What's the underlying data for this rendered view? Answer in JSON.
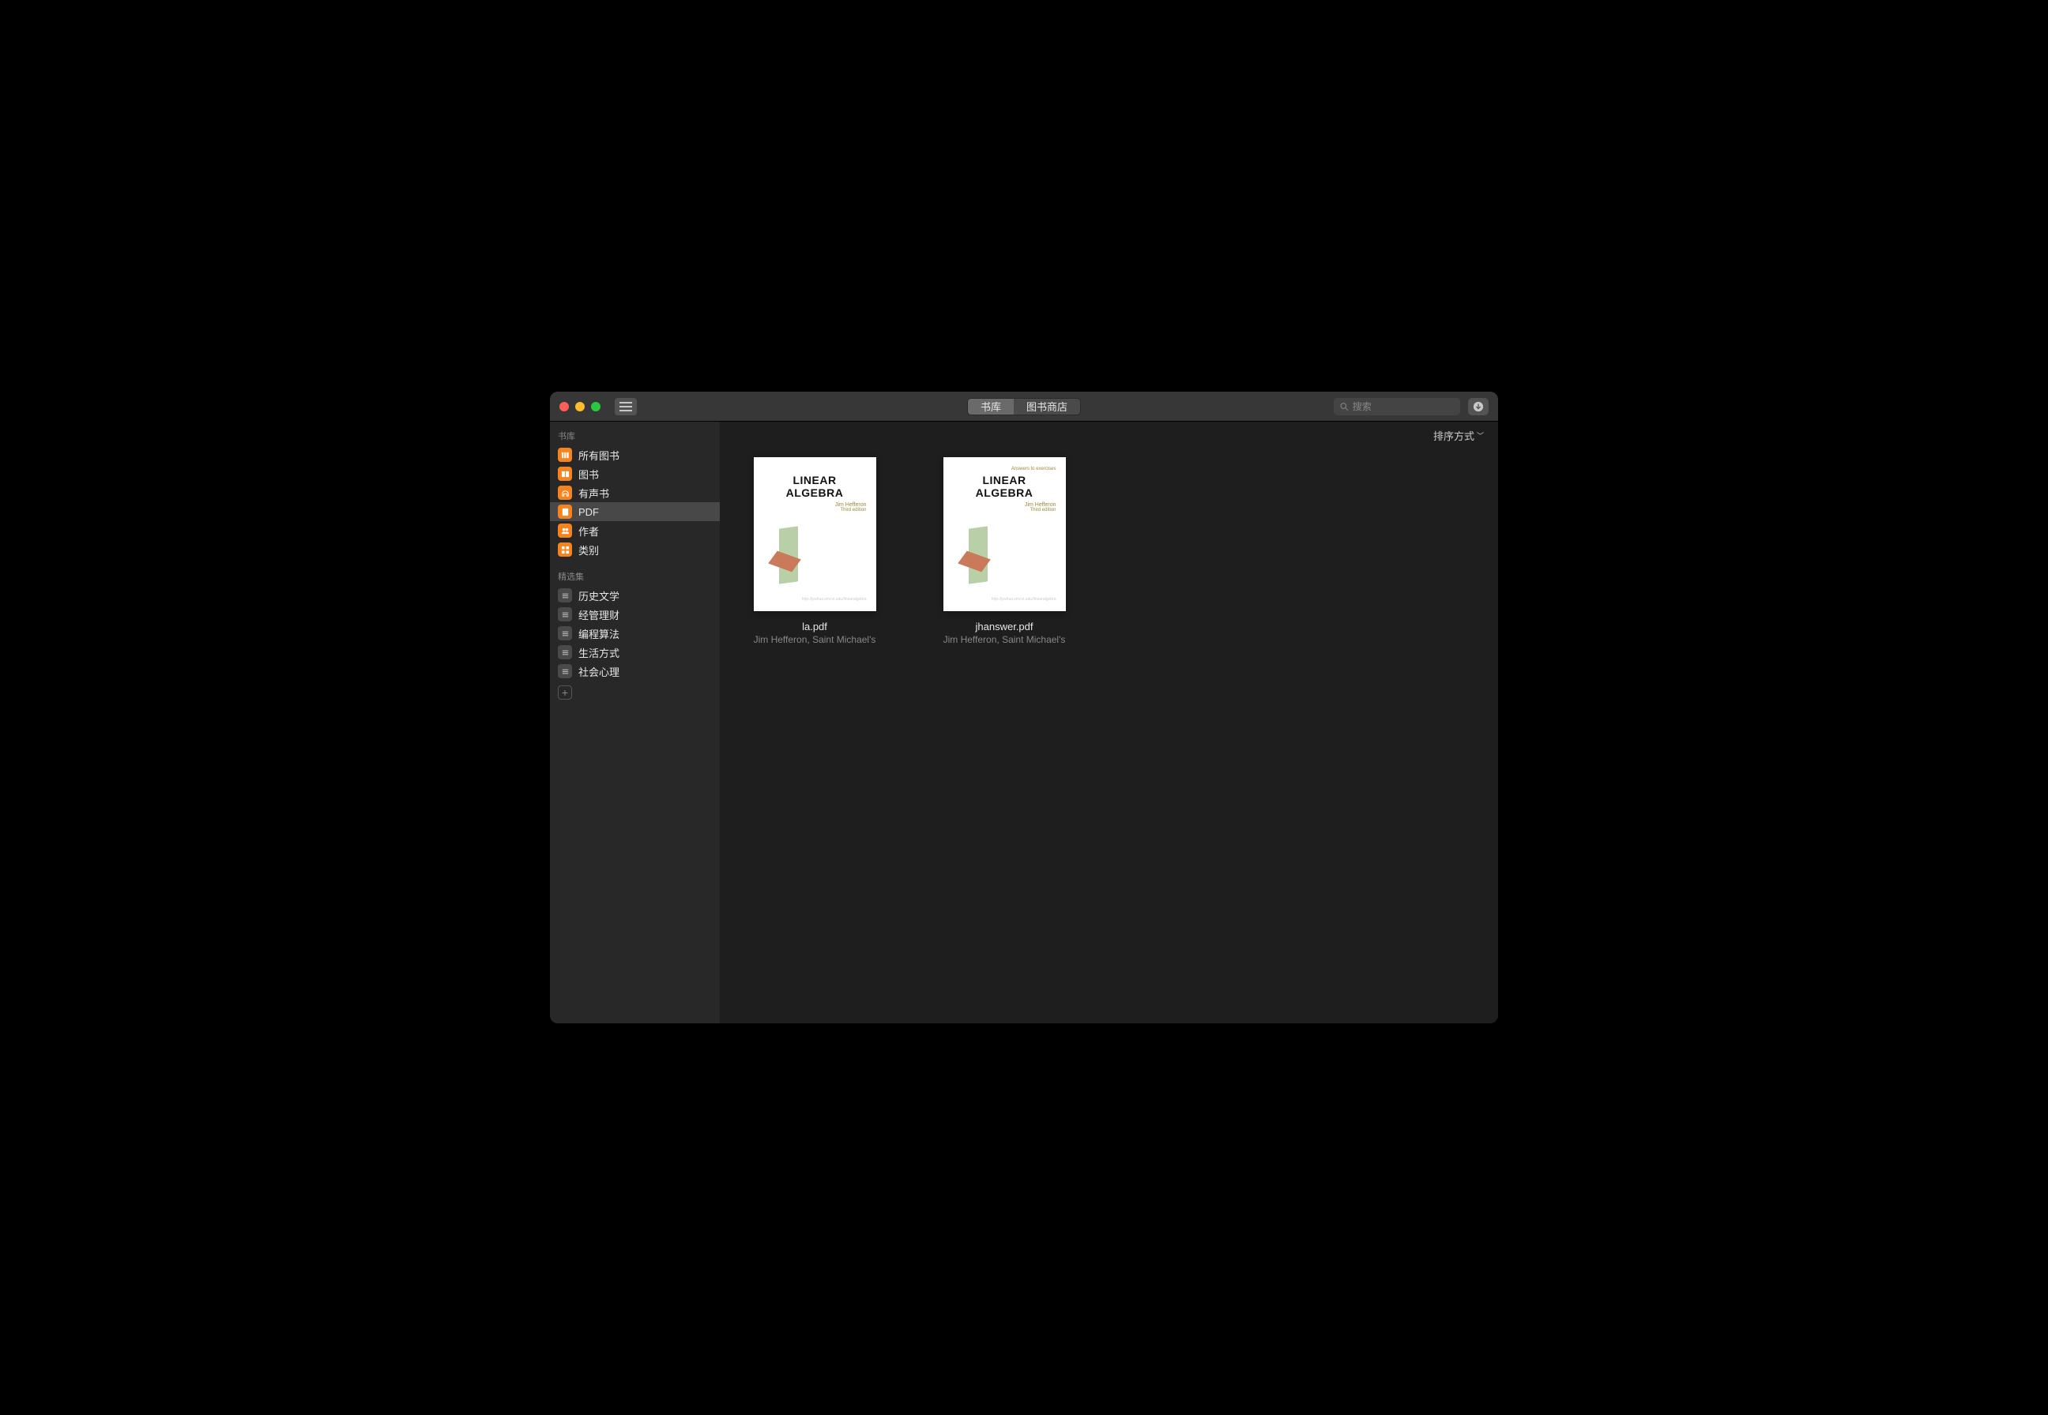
{
  "titlebar": {
    "segmented": [
      {
        "label": "书库",
        "active": true
      },
      {
        "label": "图书商店",
        "active": false
      }
    ],
    "search_placeholder": "搜索"
  },
  "sidebar": {
    "library_heading": "书库",
    "library_items": [
      {
        "label": "所有图书",
        "icon": "books-icon"
      },
      {
        "label": "图书",
        "icon": "book-icon"
      },
      {
        "label": "有声书",
        "icon": "headphones-icon"
      },
      {
        "label": "PDF",
        "icon": "pdf-icon",
        "selected": true
      },
      {
        "label": "作者",
        "icon": "person-icon"
      },
      {
        "label": "类别",
        "icon": "category-icon"
      }
    ],
    "collections_heading": "精选集",
    "collections": [
      {
        "label": "历史文学"
      },
      {
        "label": "经管理财"
      },
      {
        "label": "编程算法"
      },
      {
        "label": "生活方式"
      },
      {
        "label": "社会心理"
      }
    ]
  },
  "content": {
    "sort_label": "排序方式",
    "books": [
      {
        "cover_subtitle": "",
        "cover_title": "LINEAR ALGEBRA",
        "cover_author": "Jim Hefferon",
        "cover_edition": "Third edition",
        "cover_footer": "http://joshua.smcvt.edu/linearalgebra",
        "filename": "la.pdf",
        "author": "Jim Hefferon, Saint Michael's"
      },
      {
        "cover_subtitle": "Answers to exercises",
        "cover_title": "LINEAR ALGEBRA",
        "cover_author": "Jim Hefferon",
        "cover_edition": "Third edition",
        "cover_footer": "http://joshua.smcvt.edu/linearalgebra",
        "filename": "jhanswer.pdf",
        "author": "Jim Hefferon, Saint Michael's"
      }
    ]
  }
}
